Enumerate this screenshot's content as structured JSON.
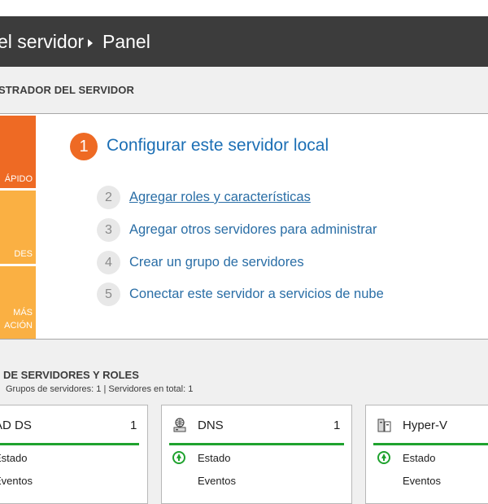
{
  "breadcrumb": {
    "part1": "el servidor",
    "part2": "Panel"
  },
  "welcome": {
    "heading": "STRADOR DEL SERVIDOR",
    "tiles": [
      {
        "label": "ÁPIDO"
      },
      {
        "label": "DES"
      },
      {
        "label_line1": "MÁS",
        "label_line2": "ACIÓN"
      }
    ],
    "main_step": {
      "number": "1",
      "label": "Configurar este servidor local"
    },
    "steps": [
      {
        "number": "2",
        "label": "Agregar roles y características"
      },
      {
        "number": "3",
        "label": "Agregar otros servidores para administrar"
      },
      {
        "number": "4",
        "label": "Crear un grupo de servidores"
      },
      {
        "number": "5",
        "label": "Conectar este servidor a servicios de nube"
      }
    ]
  },
  "roles": {
    "heading": "DE SERVIDORES Y ROLES",
    "subtitle": "Grupos de servidores: 1   |   Servidores en total: 1",
    "cards": [
      {
        "title": "AD DS",
        "count": "1",
        "status": "Estado",
        "events": "Eventos",
        "icon": "ad-ds-icon"
      },
      {
        "title": "DNS",
        "count": "1",
        "status": "Estado",
        "events": "Eventos",
        "icon": "dns-server-icon"
      },
      {
        "title": "Hyper-V",
        "count": "",
        "status": "Estado",
        "events": "Eventos",
        "icon": "hyper-v-icon"
      }
    ]
  },
  "colors": {
    "title_bar": "#3c3c3c",
    "accent_orange": "#ee6a24",
    "tile_yellow": "#fab043",
    "link_blue": "#2a6ea6",
    "status_green": "#1fa22e"
  }
}
